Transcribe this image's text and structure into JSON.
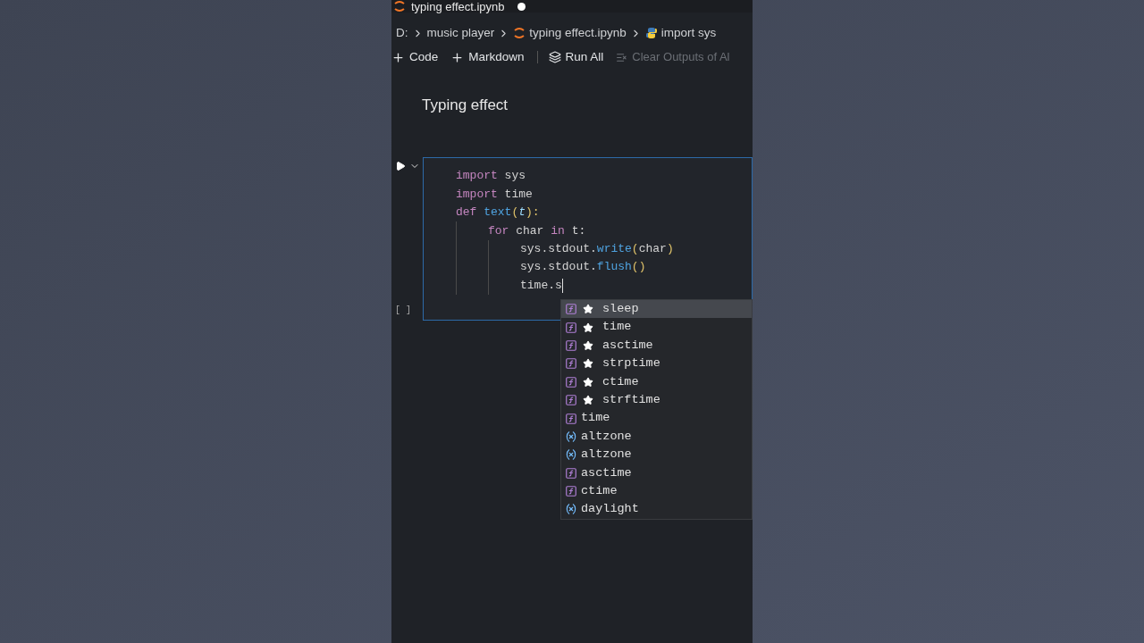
{
  "tab": {
    "title": "typing effect.ipynb",
    "unsaved": true
  },
  "breadcrumbs": [
    {
      "label": "D:",
      "kind": "folder"
    },
    {
      "label": "music player",
      "kind": "folder"
    },
    {
      "label": "typing effect.ipynb",
      "kind": "notebook"
    },
    {
      "label": "import sys",
      "kind": "cell"
    }
  ],
  "toolbar": [
    {
      "label": "Code",
      "kind": "add",
      "disabled": false
    },
    {
      "label": "Markdown",
      "kind": "add",
      "disabled": false
    },
    {
      "label": "Run All",
      "kind": "run",
      "disabled": false
    },
    {
      "label": "Clear Outputs of Al",
      "kind": "clear",
      "disabled": true
    }
  ],
  "markdown_cell": {
    "text": "Typing effect"
  },
  "code_cell": {
    "execution_count": "[ ]",
    "lines": [
      {
        "tokens": [
          {
            "text": "import",
            "kind": "keyword"
          },
          {
            "text": " sys",
            "kind": "plain"
          }
        ]
      },
      {
        "tokens": [
          {
            "text": "import",
            "kind": "keyword"
          },
          {
            "text": " time",
            "kind": "plain"
          }
        ]
      },
      {
        "tokens": [
          {
            "text": "def",
            "kind": "keyword"
          },
          {
            "text": " text",
            "kind": "function"
          },
          {
            "text": "(",
            "kind": "bracket"
          },
          {
            "text": "t",
            "kind": "param"
          },
          {
            "text": "):",
            "kind": "bracket"
          }
        ],
        "children": [
          {
            "tokens": [
              {
                "text": "for",
                "kind": "keyword"
              },
              {
                "text": " char ",
                "kind": "plain"
              },
              {
                "text": "in",
                "kind": "keyword"
              },
              {
                "text": " t:",
                "kind": "plain"
              }
            ],
            "children": [
              {
                "tokens": [
                  {
                    "text": "sys.stdout.",
                    "kind": "plain"
                  },
                  {
                    "text": "write",
                    "kind": "function"
                  },
                  {
                    "text": "(",
                    "kind": "bracket"
                  },
                  {
                    "text": "char",
                    "kind": "plain"
                  },
                  {
                    "text": ")",
                    "kind": "bracket"
                  }
                ]
              },
              {
                "tokens": [
                  {
                    "text": "sys.stdout.",
                    "kind": "plain"
                  },
                  {
                    "text": "flush",
                    "kind": "function"
                  },
                  {
                    "text": "()",
                    "kind": "bracket"
                  }
                ]
              },
              {
                "tokens": [
                  {
                    "text": "time.s",
                    "kind": "plain"
                  }
                ],
                "cursor": true
              }
            ]
          }
        ]
      }
    ]
  },
  "suggestions": [
    {
      "label": "sleep",
      "kind": "function",
      "starred": true,
      "selected": true
    },
    {
      "label": "time",
      "kind": "function",
      "starred": true,
      "selected": false
    },
    {
      "label": "asctime",
      "kind": "function",
      "starred": true,
      "selected": false
    },
    {
      "label": "strptime",
      "kind": "function",
      "starred": true,
      "selected": false
    },
    {
      "label": "ctime",
      "kind": "function",
      "starred": true,
      "selected": false
    },
    {
      "label": "strftime",
      "kind": "function",
      "starred": true,
      "selected": false
    },
    {
      "label": "time",
      "kind": "function",
      "starred": false,
      "selected": false
    },
    {
      "label": "altzone",
      "kind": "variable",
      "starred": false,
      "selected": false
    },
    {
      "label": "altzone",
      "kind": "variable",
      "starred": false,
      "selected": false
    },
    {
      "label": "asctime",
      "kind": "function",
      "starred": false,
      "selected": false
    },
    {
      "label": "ctime",
      "kind": "function",
      "starred": false,
      "selected": false
    },
    {
      "label": "daylight",
      "kind": "variable",
      "starred": false,
      "selected": false
    }
  ]
}
